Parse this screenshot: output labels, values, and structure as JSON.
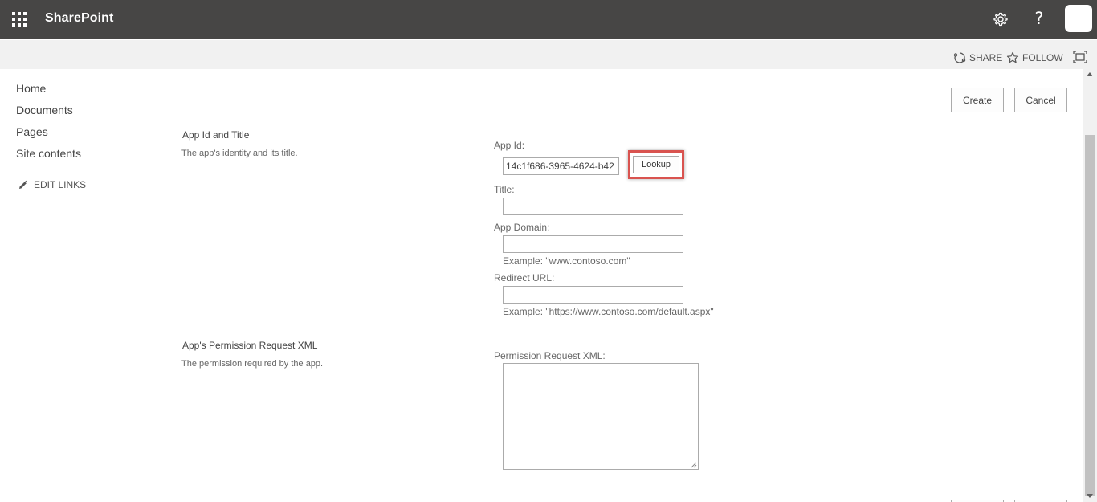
{
  "suitebar": {
    "app_name": "SharePoint",
    "help_label": "?"
  },
  "commandbar": {
    "share_label": "SHARE",
    "follow_label": "FOLLOW"
  },
  "leftnav": {
    "items": [
      {
        "label": "Home"
      },
      {
        "label": "Documents"
      },
      {
        "label": "Pages"
      },
      {
        "label": "Site contents"
      }
    ],
    "edit_links_label": "EDIT LINKS"
  },
  "actions": {
    "create_label": "Create",
    "cancel_label": "Cancel"
  },
  "sections": {
    "app_id": {
      "title": "App Id and Title",
      "description": "The app's identity and its title.",
      "app_id_label": "App Id:",
      "app_id_value": "14c1f686-3965-4624-b42",
      "lookup_label": "Lookup",
      "title_label": "Title:",
      "title_value": "",
      "domain_label": "App Domain:",
      "domain_value": "",
      "domain_hint": "Example: \"www.contoso.com\"",
      "redirect_label": "Redirect URL:",
      "redirect_value": "",
      "redirect_hint": "Example: \"https://www.contoso.com/default.aspx\""
    },
    "permission": {
      "title": "App's Permission Request XML",
      "description": "The permission required by the app.",
      "xml_label": "Permission Request XML:",
      "xml_value": ""
    }
  },
  "colors": {
    "suitebar_bg": "#474645",
    "commandbar_bg": "#f1f1f1",
    "highlight_border": "#d9534f"
  }
}
